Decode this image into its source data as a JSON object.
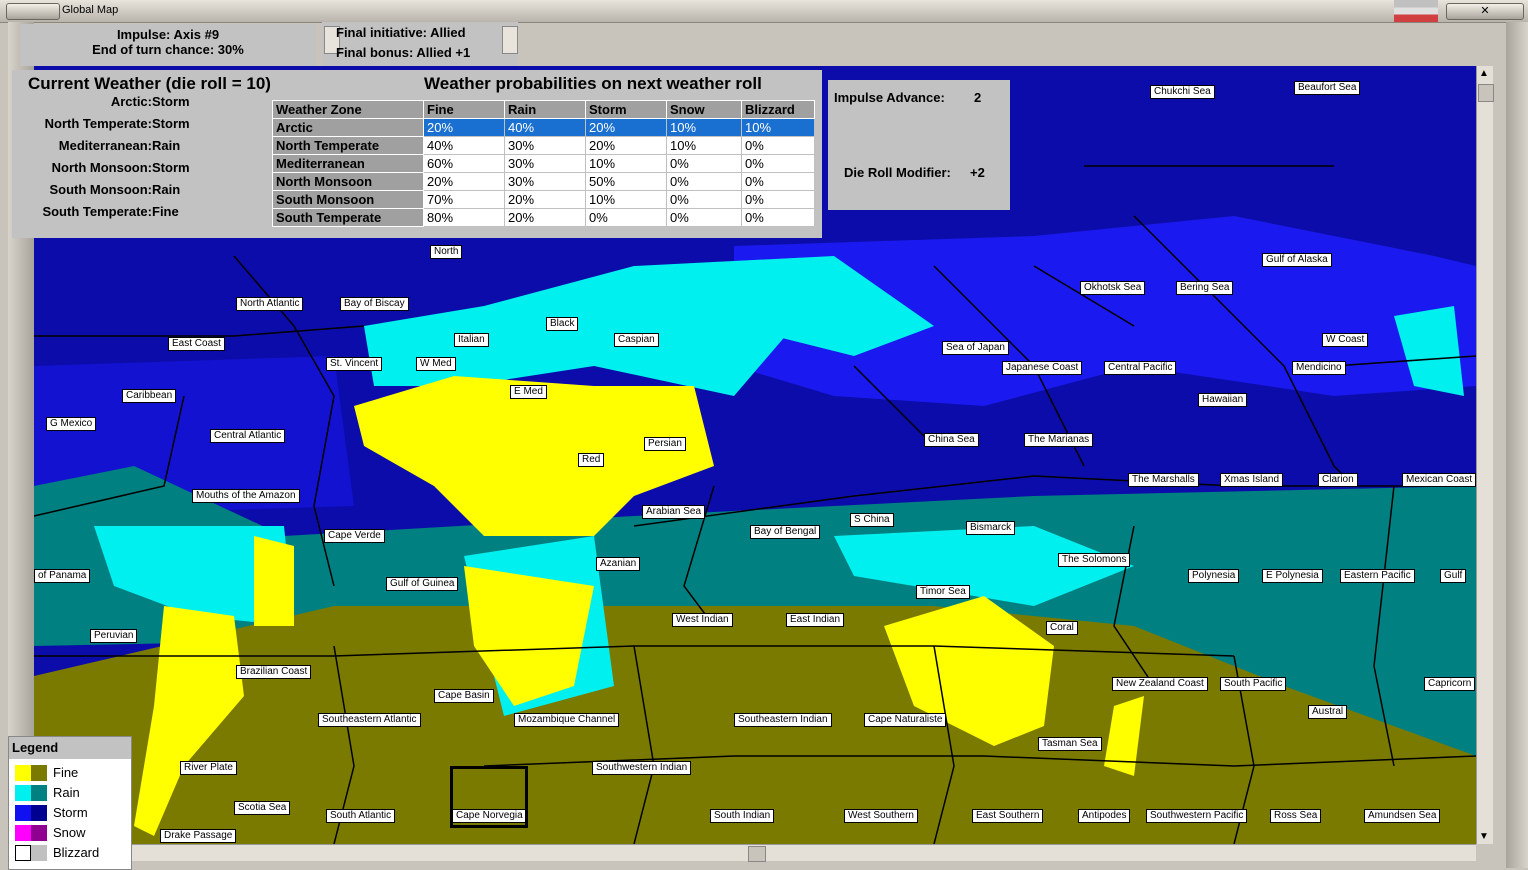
{
  "window": {
    "title": "Global Map"
  },
  "impulse": {
    "line1": "Impulse: Axis #9",
    "line2": "End of turn chance: 30%"
  },
  "initiative": {
    "line1": "Final initiative: Allied",
    "line2": "Final bonus: Allied +1"
  },
  "current_weather": {
    "title": "Current Weather (die roll = 10)",
    "zones": [
      {
        "name": "Arctic:",
        "value": "Storm"
      },
      {
        "name": "North Temperate:",
        "value": "Storm"
      },
      {
        "name": "Mediterranean:",
        "value": "Rain"
      },
      {
        "name": "North Monsoon:",
        "value": "Storm"
      },
      {
        "name": "South Monsoon:",
        "value": "Rain"
      },
      {
        "name": "South Temperate:",
        "value": "Fine"
      }
    ]
  },
  "probabilities": {
    "title": "Weather probabilities on next weather roll",
    "headers": [
      "Weather Zone",
      "Fine",
      "Rain",
      "Storm",
      "Snow",
      "Blizzard"
    ],
    "rows": [
      [
        "Arctic",
        "20%",
        "40%",
        "20%",
        "10%",
        "10%"
      ],
      [
        "North Temperate",
        "40%",
        "30%",
        "20%",
        "10%",
        "0%"
      ],
      [
        "Mediterranean",
        "60%",
        "30%",
        "10%",
        "0%",
        "0%"
      ],
      [
        "North Monsoon",
        "20%",
        "30%",
        "50%",
        "0%",
        "0%"
      ],
      [
        "South Monsoon",
        "70%",
        "20%",
        "10%",
        "0%",
        "0%"
      ],
      [
        "South Temperate",
        "80%",
        "20%",
        "0%",
        "0%",
        "0%"
      ]
    ]
  },
  "advance": {
    "impulse_label": "Impulse Advance:",
    "impulse_value": "2",
    "die_label": "Die Roll Modifier:",
    "die_value": "+2"
  },
  "legend": {
    "title": "Legend",
    "items": [
      {
        "label": "Fine",
        "c1": "#ffff00",
        "c2": "#7a7a00"
      },
      {
        "label": "Rain",
        "c1": "#00f0f0",
        "c2": "#008080"
      },
      {
        "label": "Storm",
        "c1": "#1010f0",
        "c2": "#000090"
      },
      {
        "label": "Snow",
        "c1": "#ff00ff",
        "c2": "#900090"
      },
      {
        "label": "Blizzard",
        "c1": "#ffffff",
        "c2": "#c0c0c0"
      }
    ]
  },
  "sea_labels": [
    "Chukchi Sea",
    "Beaufort Sea",
    "North",
    "North Atlantic",
    "Bay of Biscay",
    "Black",
    "Italian",
    "Caspian",
    "East Coast",
    "St. Vincent",
    "W Med",
    "E Med",
    "Caribbean",
    "G Mexico",
    "Central Atlantic",
    "Persian",
    "Red",
    "Mouths of the Amazon",
    "Arabian Sea",
    "Cape Verde",
    "Gulf of Guinea",
    "Azanian",
    "of Panama",
    "Peruvian",
    "Brazilian Coast",
    "Cape Basin",
    "Southeastern Atlantic",
    "Mozambique Channel",
    "River Plate",
    "Scotia Sea",
    "Drake Passage",
    "South Atlantic",
    "Cape Norvegia",
    "Southwestern Indian",
    "South Indian",
    "Southeastern Indian",
    "Cape Naturaliste",
    "West Indian",
    "East Indian",
    "Bay of Bengal",
    "S China",
    "Bismarck",
    "Timor Sea",
    "The Solomons",
    "Coral",
    "Polynesia",
    "E Polynesia",
    "Eastern Pacific",
    "Gulf",
    "New Zealand Coast",
    "South Pacific",
    "Capricorn",
    "Austral",
    "Tasman Sea",
    "West Southern",
    "East Southern",
    "Antipodes",
    "Southwestern Pacific",
    "Ross Sea",
    "Amundsen Sea",
    "Okhotsk Sea",
    "Bering Sea",
    "Gulf of Alaska",
    "W Coast",
    "Sea of Japan",
    "Japanese Coast",
    "Central Pacific",
    "Mendicino",
    "Hawaiian",
    "China Sea",
    "The Marianas",
    "The Marshalls",
    "Xmas Island",
    "Clarion",
    "Mexican Coast"
  ]
}
